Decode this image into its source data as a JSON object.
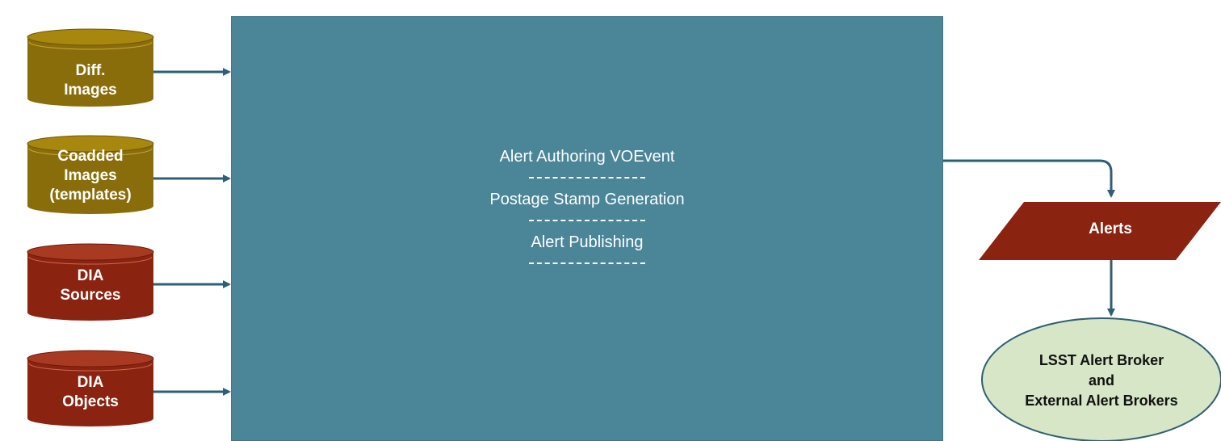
{
  "inputs": [
    {
      "lines": [
        "Diff.",
        "Images"
      ],
      "color": "#8a6d0b"
    },
    {
      "lines": [
        "Coadded",
        "Images",
        "(templates)"
      ],
      "color": "#8a6d0b"
    },
    {
      "lines": [
        "DIA",
        "Sources"
      ],
      "color": "#8b2311"
    },
    {
      "lines": [
        "DIA",
        "Objects"
      ],
      "color": "#8b2311"
    }
  ],
  "process": {
    "steps": [
      "Alert Authoring VOEvent",
      "Postage Stamp Generation",
      "Alert Publishing"
    ],
    "color": "#4b8598"
  },
  "output": {
    "label": "Alerts",
    "color": "#8b2311"
  },
  "consumer": {
    "lines": [
      "LSST Alert Broker",
      "and",
      "External Alert Brokers"
    ],
    "color": "#d6e6c6"
  },
  "arrow_color": "#2f5f74"
}
